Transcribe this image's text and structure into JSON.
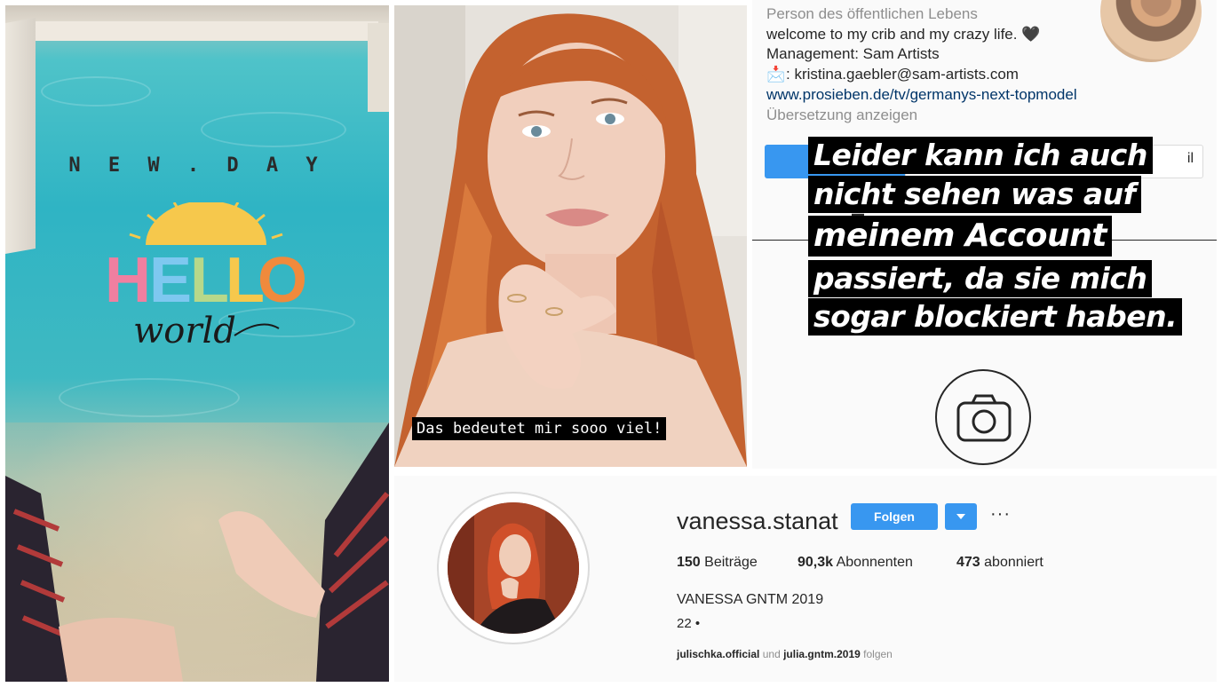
{
  "pool_story": {
    "headline": "N E W . D A Y",
    "sticker_word_1": "HELLO",
    "sticker_word_2": "world"
  },
  "video_story": {
    "caption": "Das bedeutet mir sooo viel!"
  },
  "profile_bio": {
    "category": "Person des öffentlichen Lebens",
    "bio_line": "welcome to my crib and my crazy life. 🖤",
    "management": "Management: Sam Artists",
    "email": "kristina.gaebler@sam-artists.com",
    "website": "www.prosieben.de/tv/germanys-next-topmodel",
    "translate_link": "Übersetzung anzeigen",
    "button_fragment": "il",
    "overlay_lines": [
      "Leider kann ich auch",
      "nicht sehen was auf",
      "meinem Account",
      "passiert, da sie mich",
      "sogar blockiert haben."
    ],
    "icon": "camera-icon"
  },
  "profile_header": {
    "username": "vanessa.stanat",
    "follow_label": "Folgen",
    "more_label": "···",
    "stats": {
      "posts_count": "150",
      "posts_label": "Beiträge",
      "followers_count": "90,3k",
      "followers_label": "Abonnenten",
      "following_count": "473",
      "following_label": "abonniert"
    },
    "full_name": "VANESSA GNTM 2019",
    "bio": "22 •",
    "followed_by": {
      "user_1": "julischka.official",
      "conjunction": "und",
      "user_2": "julia.gntm.2019",
      "suffix": "folgen"
    }
  },
  "colors": {
    "accent_blue": "#3897f0",
    "text_dark": "#262626",
    "text_muted": "#8e8e8e"
  }
}
